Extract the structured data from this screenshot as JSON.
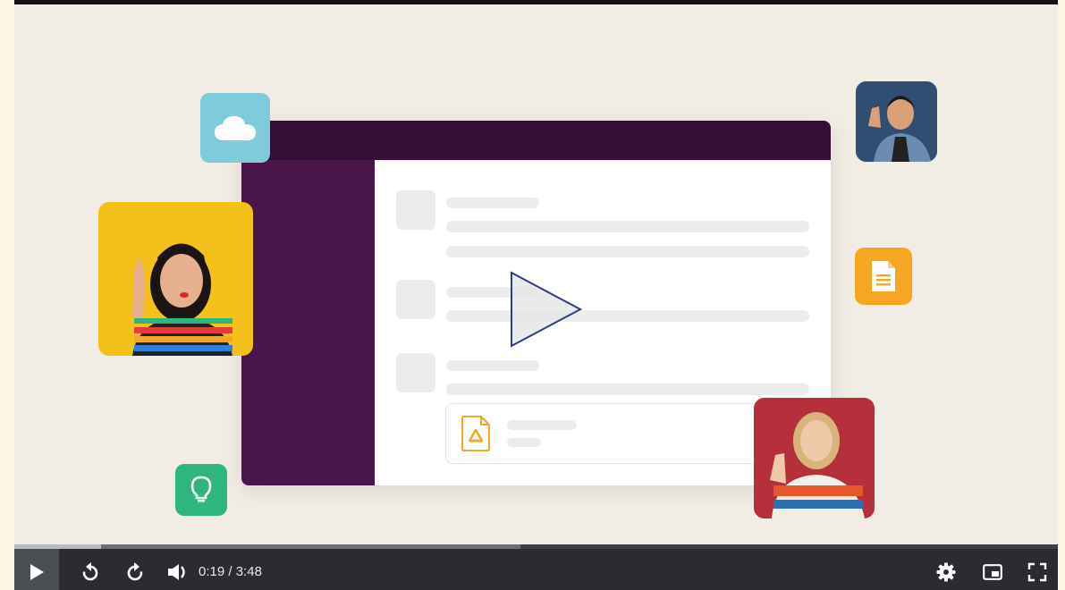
{
  "player": {
    "current_time": "0:19",
    "separator": " / ",
    "duration": "3:48",
    "progress": 0.083,
    "buffered": 0.485
  },
  "controls": {
    "play_icon": "play-icon",
    "rewind_icon": "rewind-icon",
    "forward_icon": "forward-icon",
    "volume_icon": "volume-icon",
    "settings_icon": "gear-icon",
    "pip_icon": "picture-in-picture-icon",
    "fullscreen_icon": "fullscreen-icon"
  },
  "colors": {
    "slack_aubergine": "#4a154b",
    "titlebar": "#350d36",
    "accent_green": "#2eb67d",
    "accent_yellow": "#f5a623",
    "accent_blue": "#7fcbdc",
    "control_bar": "#2a2c30"
  }
}
